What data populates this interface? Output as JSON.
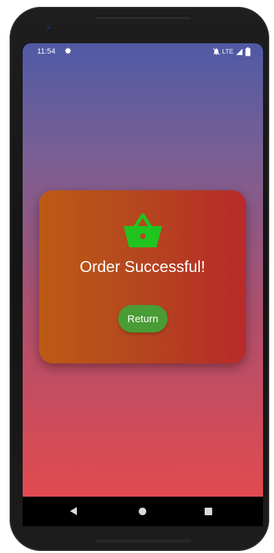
{
  "status_bar": {
    "time": "11:54",
    "network": "LTE",
    "icons": [
      "gear-icon",
      "mute-icon",
      "signal-icon",
      "battery-icon"
    ]
  },
  "card": {
    "icon": "basket-icon",
    "title": "Order Successful!",
    "return_label": "Return"
  },
  "nav_bar": {
    "icons": [
      "back-icon",
      "home-icon",
      "recents-icon"
    ]
  },
  "colors": {
    "background_top": "#4f5aa5",
    "background_bottom": "#e14a4f",
    "card_left": "#bd5a14",
    "card_right": "#b82a28",
    "basket": "#1fc41f",
    "return_button": "#4a9c35"
  }
}
